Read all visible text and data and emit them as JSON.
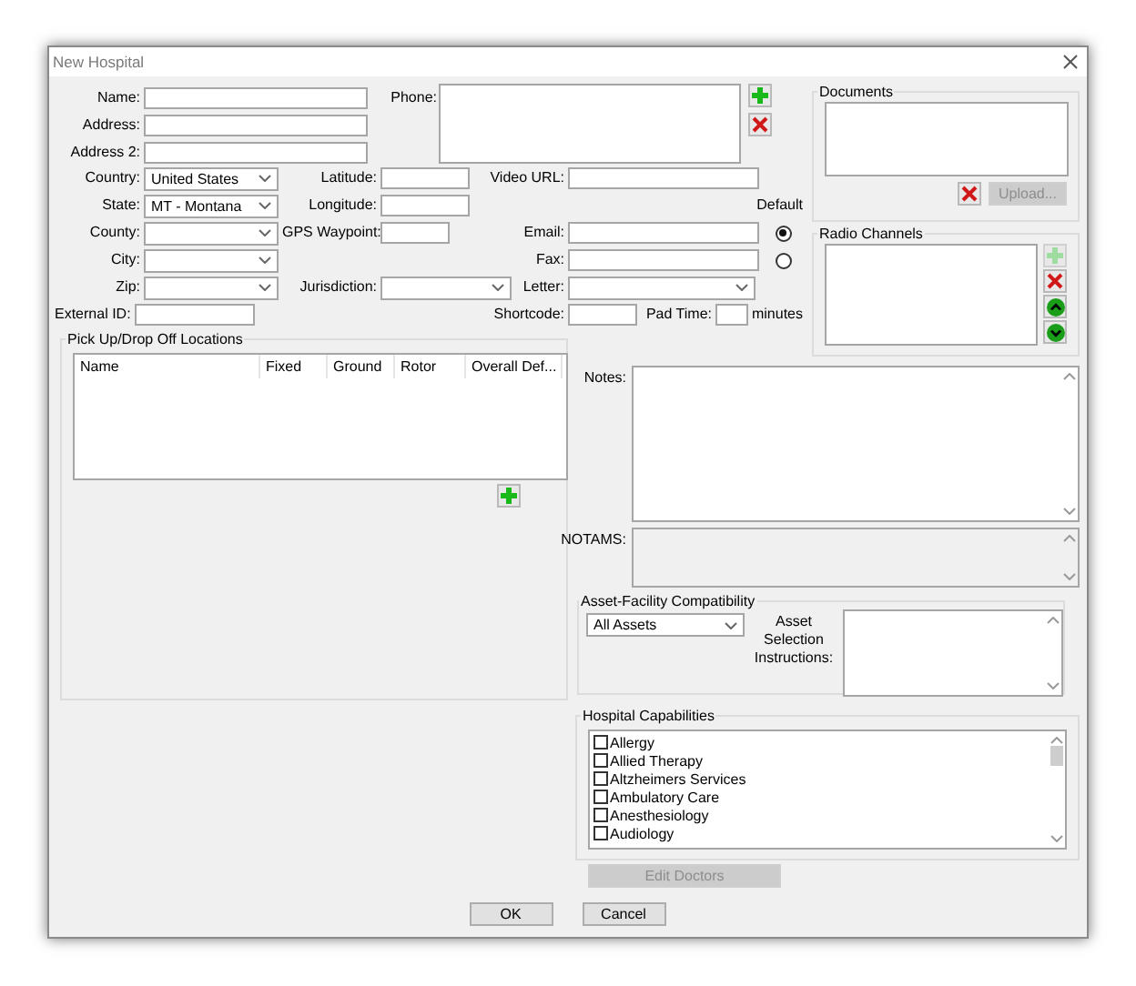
{
  "window": {
    "title": "New Hospital"
  },
  "name_fields": [
    {
      "label": "Name:"
    },
    {
      "label": "Address:"
    },
    {
      "label": "Address 2:"
    }
  ],
  "phone": {
    "label": "Phone:"
  },
  "location_fields": [
    {
      "label": "Country:",
      "value": "United States"
    },
    {
      "label": "State:",
      "value": "MT - Montana"
    },
    {
      "label": "County:"
    },
    {
      "label": "City:"
    },
    {
      "label": "Zip:"
    }
  ],
  "external_id": {
    "label": "External ID:"
  },
  "geo_fields": [
    {
      "label": "Latitude:"
    },
    {
      "label": "Longitude:"
    },
    {
      "label": "GPS Waypoint:"
    }
  ],
  "jurisdiction": {
    "label": "Jurisdiction:"
  },
  "video_url": {
    "label": "Video URL:"
  },
  "default_label": "Default",
  "contact_fields": [
    {
      "label": "Email:",
      "selected": true
    },
    {
      "label": "Fax:",
      "selected": false
    }
  ],
  "letter": {
    "label": "Letter:"
  },
  "shortcode": {
    "label": "Shortcode:"
  },
  "pad_time": {
    "label": "Pad Time:",
    "unit": "minutes"
  },
  "documents": {
    "title": "Documents",
    "upload_button": {
      "label": "Upload...",
      "disabled": true
    }
  },
  "radio_channels": {
    "title": "Radio Channels",
    "add_disabled": true
  },
  "pickup_locations": {
    "title": "Pick Up/Drop Off Locations",
    "columns": [
      "Name",
      "Fixed",
      "Ground",
      "Rotor",
      "Overall Def..."
    ]
  },
  "notes": {
    "label": "Notes:"
  },
  "notams": {
    "label": "NOTAMS:",
    "disabled": true
  },
  "asset_compatibility": {
    "title": "Asset-Facility Compatibility",
    "selection": "All Assets",
    "instructions_label": "Asset Selection Instructions:"
  },
  "capabilities": {
    "title": "Hospital Capabilities",
    "items": [
      {
        "label": "Allergy",
        "checked": false
      },
      {
        "label": "Allied Therapy",
        "checked": false
      },
      {
        "label": "Altzheimers Services",
        "checked": false
      },
      {
        "label": "Ambulatory Care",
        "checked": false
      },
      {
        "label": "Anesthesiology",
        "checked": false
      },
      {
        "label": "Audiology",
        "checked": false
      }
    ]
  },
  "edit_doctors": {
    "label": "Edit Doctors",
    "disabled": true
  },
  "buttons": [
    {
      "label": "OK"
    },
    {
      "label": "Cancel"
    }
  ]
}
